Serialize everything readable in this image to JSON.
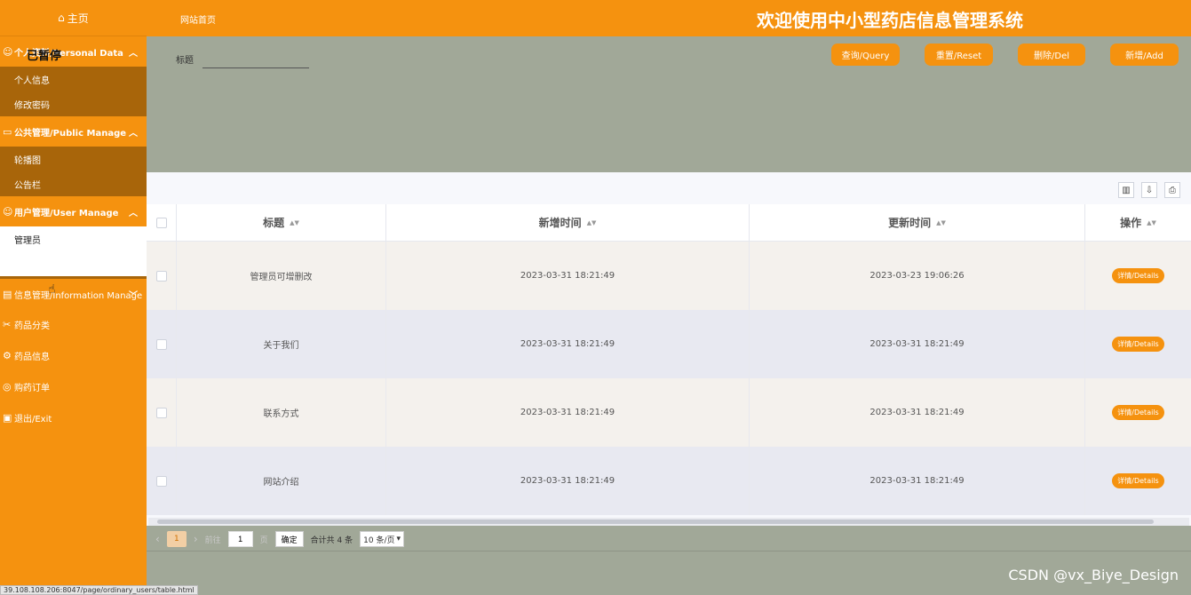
{
  "sidebar": {
    "home": "主页",
    "personal": {
      "title": "个人资料/Personal Data",
      "items": [
        "个人信息",
        "修改密码"
      ]
    },
    "public": {
      "title": "公共管理/Public Manage",
      "items": [
        "轮播图",
        "公告栏"
      ]
    },
    "users": {
      "title": "用户管理/User Manage",
      "items": [
        "管理员"
      ]
    },
    "info": {
      "title": "信息管理/Information Manage"
    },
    "flat": [
      "药品分类",
      "药品信息",
      "购药订单",
      "退出/Exit"
    ],
    "paused": "已暂停"
  },
  "topbar": {
    "breadcrumb": "网站首页",
    "title": "欢迎使用中小型药店信息管理系统"
  },
  "search": {
    "label": "标题",
    "value": ""
  },
  "buttons": {
    "query": "查询/Query",
    "reset": "重置/Reset",
    "del": "删除/Del",
    "add": "新增/Add"
  },
  "table": {
    "headers": [
      "标题",
      "新增时间",
      "更新时间",
      "操作"
    ],
    "details_label": "详情/Details",
    "rows": [
      {
        "title": "管理员可增删改",
        "created": "2023-03-31 18:21:49",
        "updated": "2023-03-23 19:06:26"
      },
      {
        "title": "关于我们",
        "created": "2023-03-31 18:21:49",
        "updated": "2023-03-31 18:21:49"
      },
      {
        "title": "联系方式",
        "created": "2023-03-31 18:21:49",
        "updated": "2023-03-31 18:21:49"
      },
      {
        "title": "网站介绍",
        "created": "2023-03-31 18:21:49",
        "updated": "2023-03-31 18:21:49"
      }
    ]
  },
  "pager": {
    "current": "1",
    "goto_label": "前往",
    "goto_value": "1",
    "goto_suffix": "页",
    "ok": "确定",
    "total": "合计共 4 条",
    "size": "10 条/页"
  },
  "status_url": "39.108.108.206:8047/page/ordinary_users/table.html",
  "watermark": "CSDN @vx_Biye_Design",
  "colors": {
    "accent": "#f5920f",
    "submenu": "#a8650a",
    "content_bg": "#a1a898"
  }
}
